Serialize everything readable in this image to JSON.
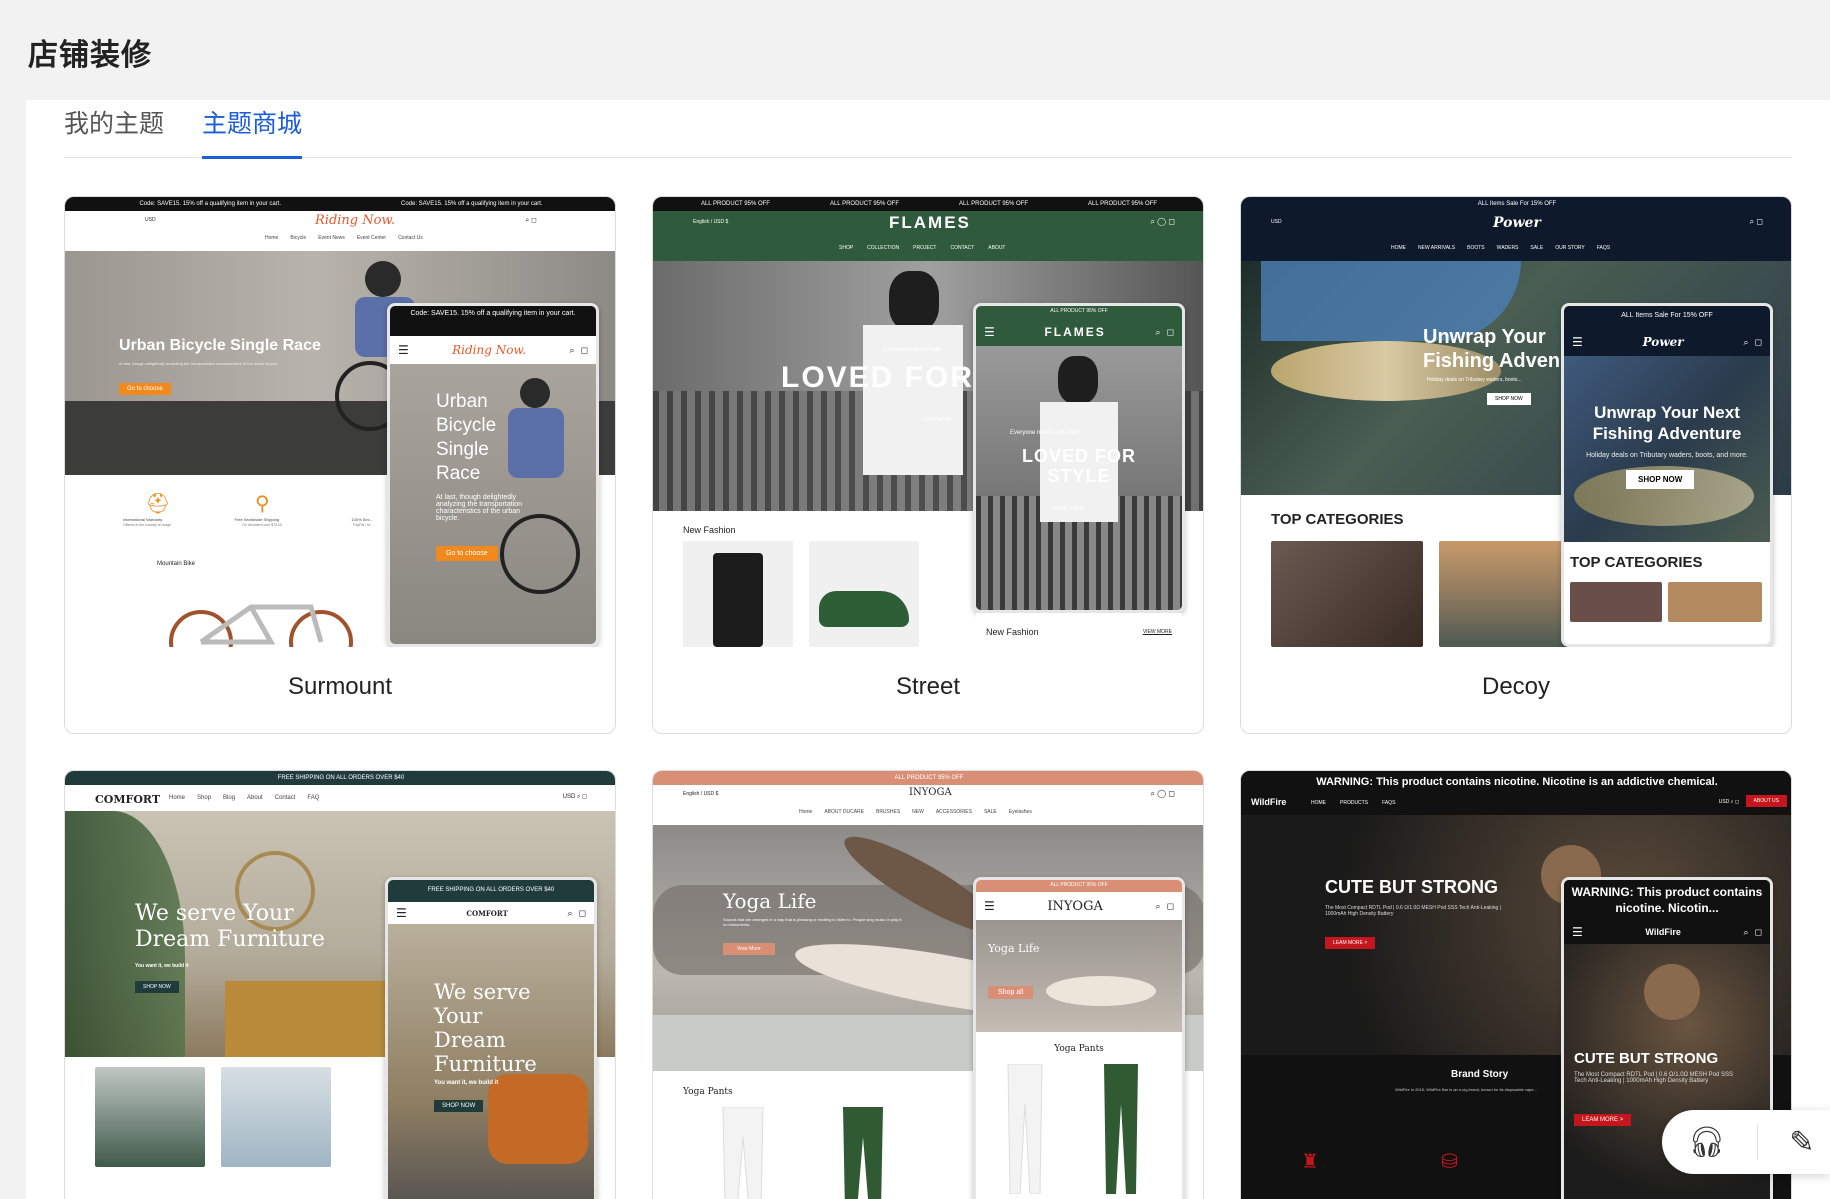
{
  "page": {
    "title": "店铺装修"
  },
  "tabs": [
    {
      "label": "我的主题",
      "active": false
    },
    {
      "label": "主题商城",
      "active": true
    }
  ],
  "colors": {
    "accent": "#1a5fd8"
  },
  "themes": [
    {
      "name": "Surmount",
      "announcement": "Code: SAVE15. 15% off a qualifying item in your cart.",
      "logo": "Riding Now.",
      "currency": "USD",
      "nav": [
        "Home",
        "Bicycle",
        "Event News",
        "Event Center",
        "Contact Us"
      ],
      "hero_title": "Urban Bicycle Single Race",
      "hero_text": "At last, though delightedly analyzing the transportation characteristics of the urban bicycle.",
      "button": "Go to choose",
      "features": [
        "International Warranty",
        "Free Worldwide Shipping",
        "100% Sec..."
      ],
      "feature_sub": [
        "Offered in the country of usage",
        "On all orders over $75.00",
        "PayPal / M..."
      ],
      "section": "Mountain Bike",
      "phone_announcement": "Code: SAVE15. 15% off a qualifying item in your cart.",
      "phone_hero_title": "Urban Bicycle Single Race",
      "phone_hero_text": "At last, though delightedly analyzing the transportation characteristics of the urban bicycle.",
      "phone_button": "Go to choose"
    },
    {
      "name": "Street",
      "announcement": "ALL PRODUCT 95% OFF",
      "logo": "FLAMES",
      "language": "English / USD $",
      "nav": [
        "SHOP",
        "COLLECTION",
        "PROJECT",
        "CONTACT",
        "ABOUT"
      ],
      "hero_title": "LOVED FOR",
      "hero_kicker": "Everyone needs a fit outfit",
      "hero_button": "SHOP NOW",
      "section": "New Fashion",
      "phone_announcement": "ALL PRODUCT 95% OFF",
      "phone_kicker": "Everyone needs a fit outfit",
      "phone_hero_title": "LOVED FOR STYLE",
      "phone_button": "SHOP NEW",
      "phone_section": "New Fashion",
      "phone_view_more": "VIEW MORE"
    },
    {
      "name": "Decoy",
      "announcement": "ALL Items Sale For 15% OFF",
      "logo": "Power",
      "currency": "USD",
      "nav": [
        "HOME",
        "NEW ARRIVALS",
        "BOOTS",
        "WADERS",
        "SALE",
        "OUR STORY",
        "FAQS"
      ],
      "hero_title": "Unwrap Your Fishing Adven",
      "hero_text": "Holiday deals on Tributary waders, boots...",
      "hero_button": "SHOP NOW",
      "section": "TOP CATEGORIES",
      "phone_announcement": "ALL Items Sale For 15% OFF",
      "phone_hero_title": "Unwrap Your Next Fishing Adventure",
      "phone_hero_text": "Holiday deals on Tributary waders, boots, and more.",
      "phone_button": "SHOP NOW",
      "phone_section": "TOP CATEGORIES"
    },
    {
      "name": "Comfort",
      "announcement": "FREE SHIPPING ON ALL ORDERS OVER $40",
      "logo": "COMFORT",
      "currency": "USD",
      "nav": [
        "Home",
        "Shop",
        "Blog",
        "About",
        "Contact",
        "FAQ"
      ],
      "hero_title": "We serve Your Dream Furniture",
      "hero_text": "You want it, we build it",
      "hero_button": "SHOP NOW",
      "phone_announcement": "FREE SHIPPING ON ALL ORDERS OVER $40",
      "phone_hero_title": "We serve Your Dream Furniture",
      "phone_hero_text": "You want it, we build it",
      "phone_button": "SHOP NOW"
    },
    {
      "name": "Inyoga",
      "announcement": "ALL PRODUCT 95% OFF",
      "logo": "INYOGA",
      "language": "English / USD $",
      "nav": [
        "Home",
        "ABOUT DUCARE",
        "BRUSHES",
        "NEW",
        "ACCESSORIES",
        "SALE",
        "Eyelashes"
      ],
      "hero_title": "Yoga Life",
      "hero_text": "Sounds that are arranged in a way that is pleasing or exciting to listen to. People sing music or play it on instruments.",
      "hero_button": "View More",
      "section": "Yoga Pants",
      "phone_announcement": "ALL PRODUCT 95% OFF",
      "phone_hero_title": "Yoga Life",
      "phone_button": "Shop all",
      "phone_section": "Yoga Pants"
    },
    {
      "name": "WildFire",
      "announcement": "WARNING: This product contains nicotine. Nicotine is an addictive chemical.",
      "logo": "WildFire",
      "currency": "USD",
      "nav": [
        "HOME",
        "PRODUCTS",
        "FAQS"
      ],
      "nav_button": "ABOUT US",
      "hero_title": "CUTE BUT STRONG",
      "hero_text": "The Most Compact RDTL Pod | 0.6 Ω/1.0Ω MESH Pod SSS Tech Anti-Leaking | 1000mAh High Density Battery",
      "hero_button": "LEAM MORE >",
      "section": "Brand Story",
      "section_text": "WildFire in 2015, WildFire Bar is an e-cig brand, known for its disposable vape...",
      "phone_announcement": "WARNING: This product contains nicotine. Nicotin...",
      "phone_hero_title": "CUTE BUT STRONG",
      "phone_hero_text": "The Most Compact RDTL Pod | 0.6 Ω/1.0Ω MESH Pod SSS Tech Anti-Leaking | 1000mAh High Density Battery",
      "phone_button": "LEAM MORE >"
    }
  ],
  "float_tools": {
    "support_icon": "headset-icon",
    "edit_icon": "edit-note-icon"
  }
}
